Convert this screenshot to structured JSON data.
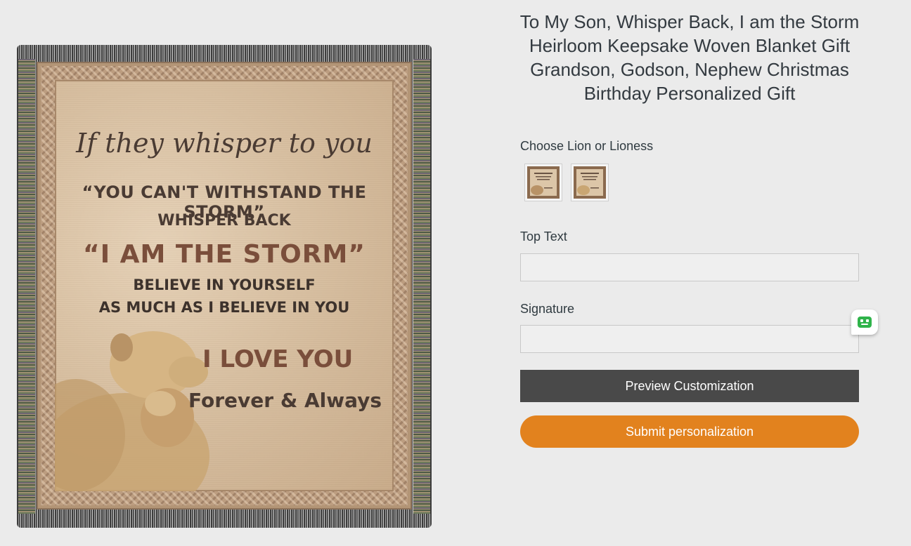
{
  "product": {
    "title": "To My Son, Whisper Back, I am the Storm Heirloom Keepsake Woven Blanket Gift Grandson, Godson, Nephew Christmas Birthday Personalized Gift",
    "image": {
      "script_line": "If they whisper to you",
      "line1": "“YOU CAN'T WITHSTAND THE STORM”",
      "line2": "WHISPER BACK",
      "line3": "“I AM THE STORM”",
      "line4": "BELIEVE IN YOURSELF",
      "line5": "AS MUCH AS I BELIEVE IN YOU",
      "line6": "I LOVE YOU",
      "line7": "Forever & Always"
    }
  },
  "options": {
    "variant_label": "Choose Lion or Lioness",
    "variants": [
      {
        "name": "lion-swatch"
      },
      {
        "name": "lioness-swatch"
      }
    ]
  },
  "form": {
    "top_text_label": "Top Text",
    "top_text_value": "",
    "signature_label": "Signature",
    "signature_value": "",
    "preview_button": "Preview Customization",
    "submit_button": "Submit personalization"
  },
  "colors": {
    "background": "#ebebeb",
    "preview_button": "#494949",
    "submit_button": "#e2821e",
    "chat_icon": "#2fb34a"
  },
  "icons": {
    "chat_widget": "chat-bot-icon"
  }
}
